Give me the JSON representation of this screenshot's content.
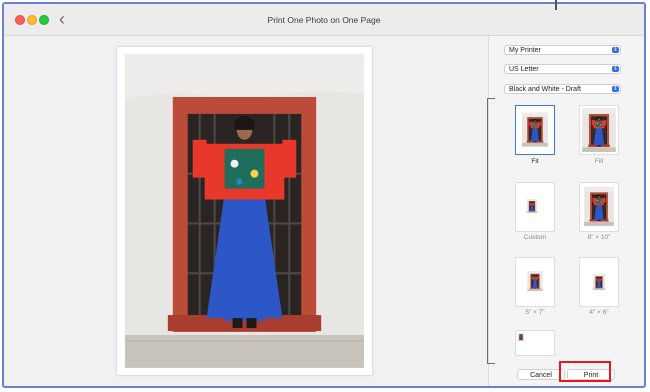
{
  "window": {
    "title": "Print One Photo on One Page"
  },
  "icons": {
    "back": "chevron-left-icon",
    "dropdown": "chevron-updown-icon"
  },
  "settings": {
    "printer": "My Printer",
    "paper_size": "US Letter",
    "quality": "Black and White - Draft"
  },
  "layouts": [
    {
      "label": "Fit",
      "selected": true
    },
    {
      "label": "Fill",
      "selected": false
    },
    {
      "label": "Custom",
      "selected": false
    },
    {
      "label": "8\" × 10\"",
      "selected": false
    },
    {
      "label": "5\" × 7\"",
      "selected": false
    },
    {
      "label": "4\" × 6\"",
      "selected": false
    },
    {
      "label": "",
      "selected": false
    }
  ],
  "buttons": {
    "cancel": "Cancel",
    "print": "Print"
  },
  "colors": {
    "accent": "#3878e8",
    "highlight": "#e2191d",
    "frame": "#6b7fd7"
  }
}
